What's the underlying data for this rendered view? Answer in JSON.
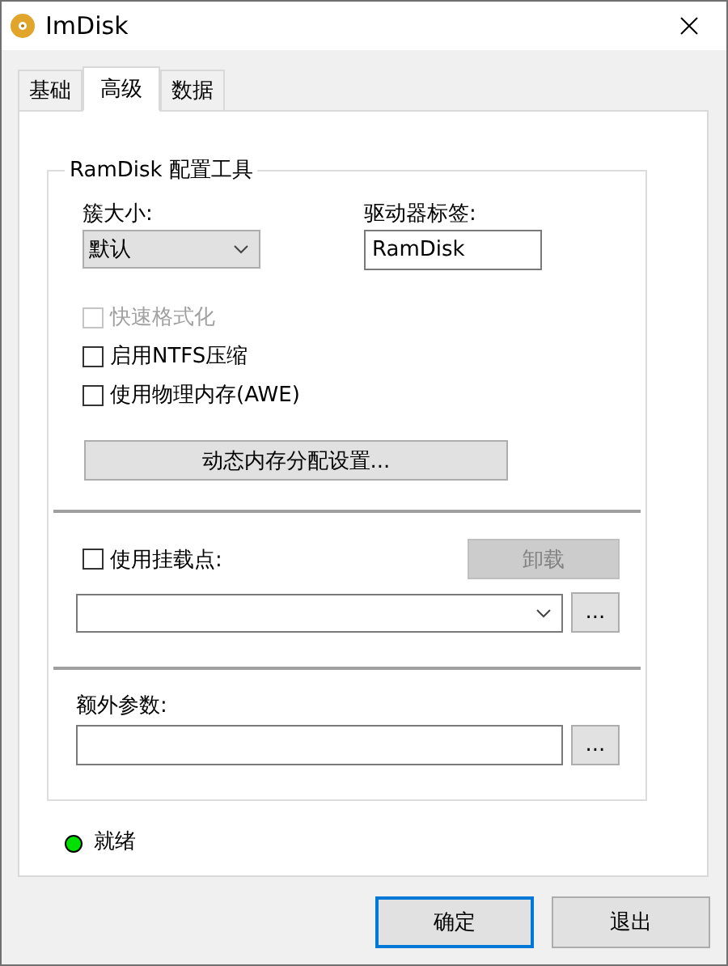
{
  "window": {
    "title": "ImDisk"
  },
  "tabs": [
    {
      "label": "基础",
      "selected": false
    },
    {
      "label": "高级",
      "selected": true
    },
    {
      "label": "数据",
      "selected": false
    }
  ],
  "group": {
    "title": "RamDisk 配置工具",
    "cluster_size": {
      "label": "簇大小:",
      "value": "默认"
    },
    "drive_label": {
      "label": "驱动器标签:",
      "value": "RamDisk"
    },
    "options": [
      {
        "label": "快速格式化",
        "checked": false,
        "disabled": true
      },
      {
        "label": "启用NTFS压缩",
        "checked": false,
        "disabled": false
      },
      {
        "label": "使用物理内存(AWE)",
        "checked": false,
        "disabled": false
      }
    ],
    "dynamic_button": "动态内存分配设置...",
    "mount_point": {
      "label": "使用挂载点:",
      "checked": false,
      "unmount_button": {
        "label": "卸载",
        "disabled": true
      },
      "browse_button": "..."
    },
    "extra_params": {
      "label": "额外参数:",
      "browse_button": "..."
    }
  },
  "status": {
    "text": "就绪",
    "color": "#00e000"
  },
  "buttons": [
    {
      "label": "确定",
      "default": true
    },
    {
      "label": "退出",
      "default": false
    }
  ]
}
